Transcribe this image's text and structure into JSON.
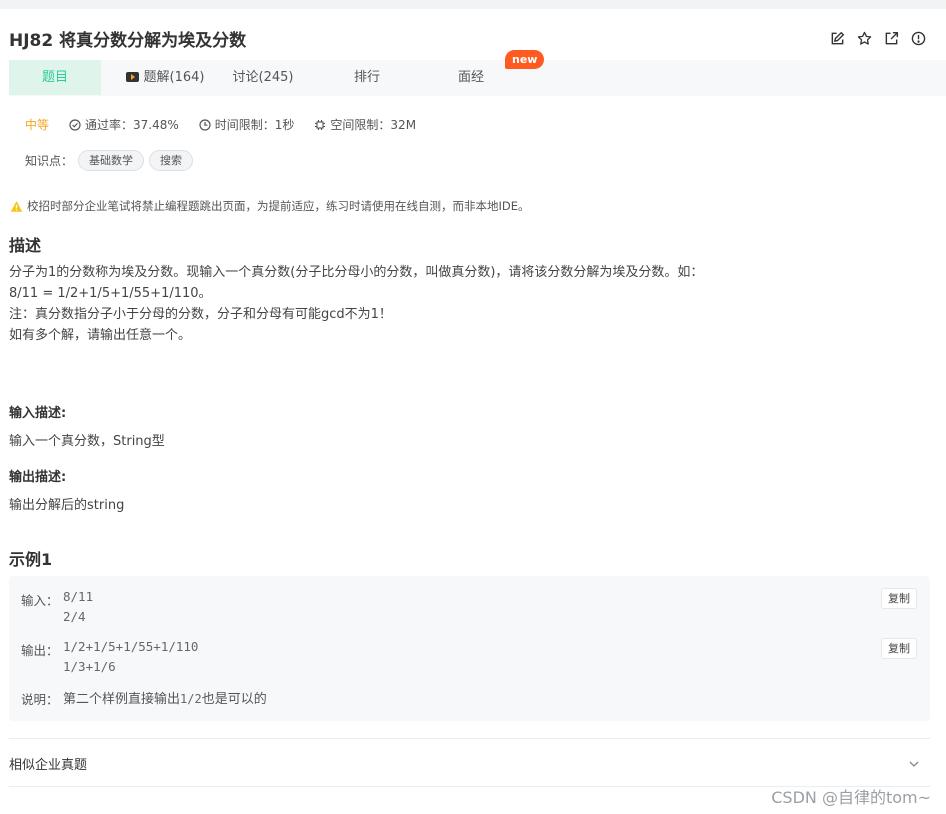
{
  "problem": {
    "title": "HJ82  将真分数分解为埃及分数",
    "tools": [
      "edit-icon",
      "star-icon",
      "share-icon",
      "report-icon"
    ]
  },
  "tabs": [
    {
      "label": "题目",
      "active": true
    },
    {
      "label": "题解(164)",
      "active": false
    },
    {
      "label": "讨论(245)",
      "active": false
    },
    {
      "label": "排行",
      "active": false
    },
    {
      "label": "面经",
      "active": false
    }
  ],
  "new_badge": "new",
  "meta": {
    "difficulty": "中等",
    "pass_rate": "通过率：37.48%",
    "time_limit": "时间限制：1秒",
    "memory_limit": "空间限制：32M"
  },
  "knowledge": {
    "label": "知识点：",
    "tags": [
      "基础数学",
      "搜索"
    ]
  },
  "warning": "校招时部分企业笔试将禁止编程题跳出页面，为提前适应，练习时请使用在线自测，而非本地IDE。",
  "description": {
    "heading": "描述",
    "lines": [
      "分子为1的分数称为埃及分数。现输入一个真分数(分子比分母小的分数，叫做真分数)，请将该分数分解为埃及分数。如：",
      "8/11 = 1/2+1/5+1/55+1/110。",
      "注：真分数指分子小于分母的分数，分子和分母有可能gcd不为1！",
      "如有多个解，请输出任意一个。"
    ]
  },
  "input_desc": {
    "heading": "输入描述:",
    "text": "输入一个真分数，String型"
  },
  "output_desc": {
    "heading": "输出描述:",
    "text": "输出分解后的string"
  },
  "example": {
    "heading": "示例1",
    "input_label": "输入：",
    "input_value": "8/11\n2/4",
    "output_label": "输出：",
    "output_value": "1/2+1/5+1/55+1/110\n1/3+1/6",
    "note_label": "说明：",
    "note_prefix": "第二个样例直接输出",
    "note_code": "1/2",
    "note_suffix": "也是可以的",
    "copy_label": "复制"
  },
  "similar": {
    "label": "相似企业真题"
  },
  "watermark": "CSDN @自律的tom~",
  "colors": {
    "accent": "#32ca99",
    "tab_active_bg": "#dff5ec",
    "difficulty": "#f5a623",
    "new_badge": "#ff5a1f",
    "warning": "#f5c518"
  }
}
